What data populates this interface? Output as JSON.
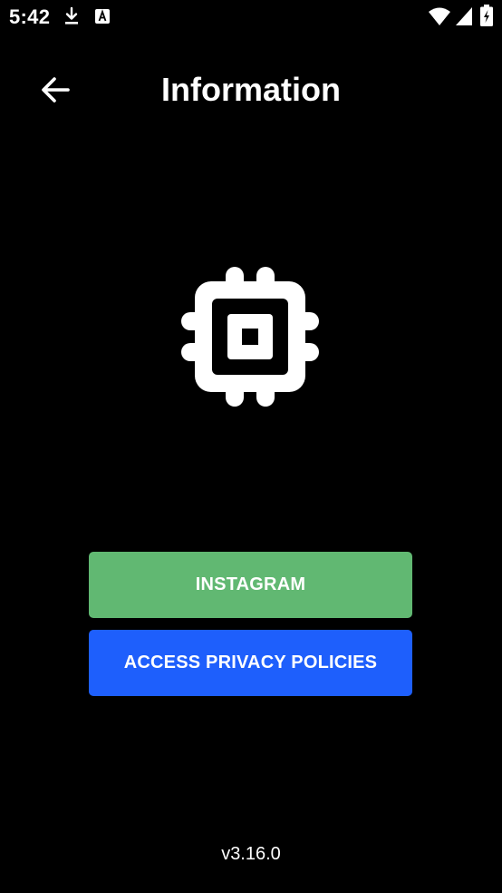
{
  "status_bar": {
    "time": "5:42",
    "icons": [
      "download-icon",
      "a-icon",
      "wifi-icon",
      "signal-icon",
      "battery-icon"
    ]
  },
  "header": {
    "back_icon": "arrow-left-icon",
    "title": "Information"
  },
  "main": {
    "hero_icon": "cpu-chip-icon",
    "instagram_label": "INSTAGRAM",
    "privacy_label": "ACCESS PRIVACY POLICIES"
  },
  "footer": {
    "version": "v3.16.0"
  },
  "colors": {
    "background": "#000000",
    "instagram_button": "#61b872",
    "privacy_button": "#1e5ffc",
    "text": "#ffffff"
  }
}
